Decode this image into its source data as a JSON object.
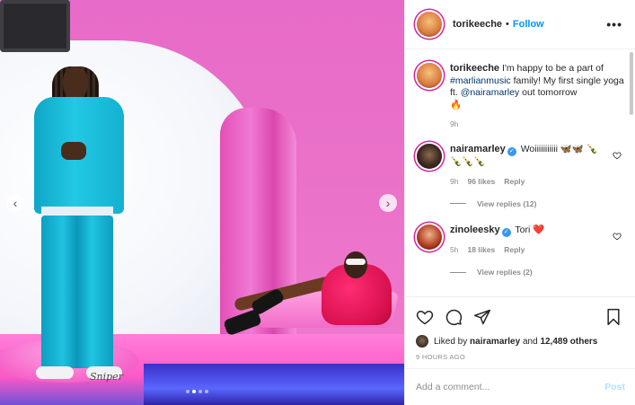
{
  "post": {
    "username": "torikeeche",
    "follow_label": "Follow",
    "separator": "•",
    "more_label": "•••",
    "signature": "Sniper",
    "carousel": {
      "prev": "‹",
      "next": "›",
      "slides": 4,
      "active": 1
    }
  },
  "caption": {
    "username": "torikeeche",
    "text_before": "I'm happy to be a part of",
    "hashtag": "#marlianmusic",
    "text_middle": "family! My first single yoga ft.",
    "mention": "@nairamarley",
    "text_after": "out tomorrow",
    "emoji": "🔥",
    "time": "9h"
  },
  "comments": [
    {
      "username": "nairamarley",
      "verified": true,
      "text": "Woiiiiiiiiiii 🦋🦋 🍾🍾🍾🍾",
      "time": "9h",
      "likes": "96 likes",
      "reply_label": "Reply",
      "view_replies": "View replies (12)"
    },
    {
      "username": "zinoleesky",
      "verified": true,
      "text": "Tori ❤️",
      "time": "5h",
      "likes": "18 likes",
      "reply_label": "Reply",
      "view_replies": "View replies (2)"
    }
  ],
  "actions": {
    "like_icon": "heart-icon",
    "comment_icon": "comment-icon",
    "share_icon": "share-icon",
    "save_icon": "bookmark-icon"
  },
  "likes": {
    "prefix": "Liked by",
    "user": "nairamarley",
    "and": "and",
    "others": "12,489 others"
  },
  "timestamp": "9 HOURS AGO",
  "add_comment": {
    "placeholder": "Add a comment...",
    "post_label": "Post"
  },
  "colors": {
    "accent": "#0095f6",
    "post_disabled": "#b2dffc",
    "muted": "#8e8e8e",
    "verified": "#3897f0"
  }
}
